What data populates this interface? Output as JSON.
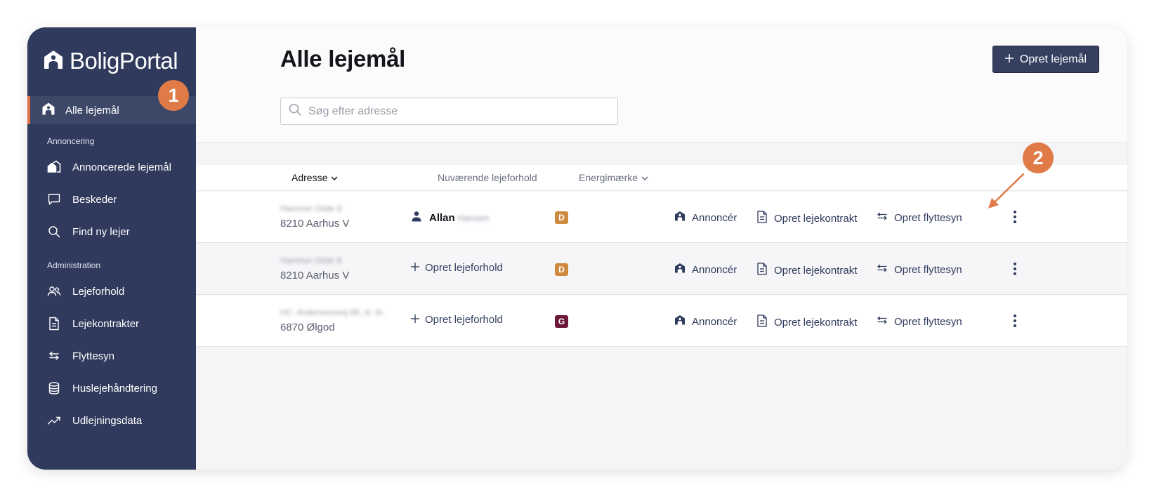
{
  "app": {
    "logo_text": "BoligPortal",
    "accent": "#e0704a",
    "sidebar_bg": "#2f3a5c"
  },
  "sidebar": {
    "active_item": {
      "label": "Alle lejemål",
      "icon": "house-icon"
    },
    "sections": [
      {
        "title": "Annoncering",
        "items": [
          {
            "label": "Annoncerede lejemål",
            "icon": "houses-icon"
          },
          {
            "label": "Beskeder",
            "icon": "chat-icon"
          },
          {
            "label": "Find ny lejer",
            "icon": "search-icon"
          }
        ]
      },
      {
        "title": "Administration",
        "items": [
          {
            "label": "Lejeforhold",
            "icon": "users-icon"
          },
          {
            "label": "Lejekontrakter",
            "icon": "document-icon"
          },
          {
            "label": "Flyttesyn",
            "icon": "arrows-icon"
          },
          {
            "label": "Huslejehåndtering",
            "icon": "database-icon"
          },
          {
            "label": "Udlejningsdata",
            "icon": "trend-icon"
          }
        ]
      }
    ]
  },
  "header": {
    "title": "Alle lejemål",
    "create_button": "Opret lejemål",
    "search_placeholder": "Søg efter adresse"
  },
  "table": {
    "columns": [
      "Adresse",
      "Nuværende lejeforhold",
      "Energimærke"
    ],
    "rows": [
      {
        "address_line1": "Hammer Gilde 8",
        "address_line2": "8210 Aarhus V",
        "tenant_first": "Allan",
        "tenant_last": "Hansen",
        "add_tenant": "",
        "energy": "D",
        "energy_color": "#d08a3f",
        "actions": [
          "Annoncér",
          "Opret lejekontrakt",
          "Opret flyttesyn"
        ]
      },
      {
        "address_line1": "Hammer Gilde 8",
        "address_line2": "8210 Aarhus V",
        "tenant_first": "",
        "tenant_last": "",
        "add_tenant": "Opret lejeforhold",
        "energy": "D",
        "energy_color": "#d08a3f",
        "actions": [
          "Annoncér",
          "Opret lejekontrakt",
          "Opret flyttesyn"
        ]
      },
      {
        "address_line1": "HC. Andersensvej 66, st. th.",
        "address_line2": "6870 Ølgod",
        "tenant_first": "",
        "tenant_last": "",
        "add_tenant": "Opret lejeforhold",
        "energy": "G",
        "energy_color": "#6b1838",
        "actions": [
          "Annoncér",
          "Opret lejekontrakt",
          "Opret flyttesyn"
        ]
      }
    ]
  },
  "annotations": [
    {
      "label": "1",
      "color": "#e07a47"
    },
    {
      "label": "2",
      "color": "#e07a47"
    }
  ]
}
